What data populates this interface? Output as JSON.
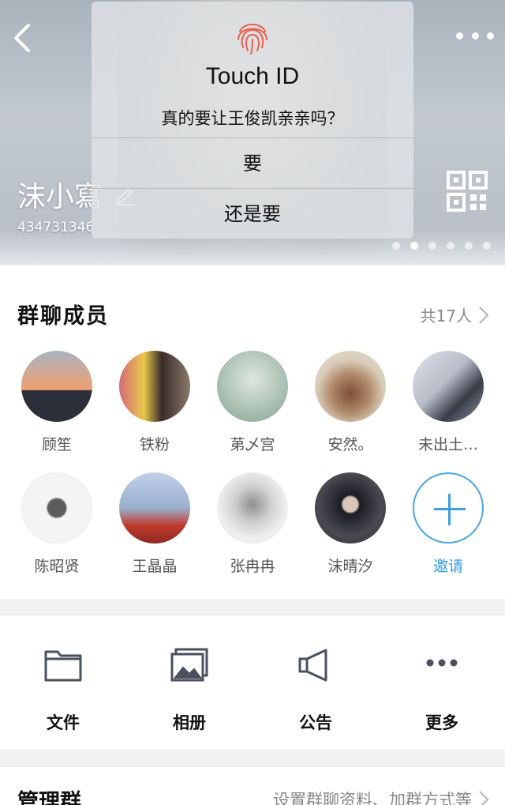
{
  "header": {
    "group_name": "沫小寫",
    "group_id": "434731346",
    "page_dots_count": 6,
    "page_dots_active": 1
  },
  "touch_id_dialog": {
    "title": "Touch ID",
    "message": "真的要让王俊凯亲亲吗？",
    "button_confirm": "要",
    "button_other": "还是要"
  },
  "members_section": {
    "title": "群聊成员",
    "count_label": "共17人",
    "members": [
      {
        "name": "顾笙",
        "colors": [
          "#f0a070",
          "#2c2f3a"
        ]
      },
      {
        "name": "铁粉",
        "colors": [
          "#d46a7a",
          "#3a2b2b"
        ]
      },
      {
        "name": "苐乄宫",
        "colors": [
          "#9fb8a8",
          "#dfe7e0"
        ]
      },
      {
        "name": "安然。",
        "colors": [
          "#d8cbb8",
          "#7b4f36"
        ]
      },
      {
        "name": "未出土…",
        "colors": [
          "#b7bcc8",
          "#3a3c48"
        ]
      },
      {
        "name": "陈昭贤",
        "colors": [
          "#f4f4f4",
          "#5c5c5c"
        ]
      },
      {
        "name": "王晶晶",
        "colors": [
          "#c0d0e8",
          "#c0392b"
        ]
      },
      {
        "name": "张冉冉",
        "colors": [
          "#eef0ef",
          "#8c8f8d"
        ]
      },
      {
        "name": "沫晴汐",
        "colors": [
          "#4a4a52",
          "#1c1c22"
        ]
      }
    ],
    "invite_label": "邀请"
  },
  "tools": [
    {
      "label": "文件",
      "icon": "folder-icon"
    },
    {
      "label": "相册",
      "icon": "photo-album-icon"
    },
    {
      "label": "公告",
      "icon": "megaphone-icon"
    },
    {
      "label": "更多",
      "icon": "more-dots-icon"
    }
  ],
  "manage": {
    "title": "管理群",
    "hint": "设置群聊资料、加群方式等"
  },
  "colors": {
    "accent": "#2f9be0",
    "icon_gray": "#4a5060"
  }
}
